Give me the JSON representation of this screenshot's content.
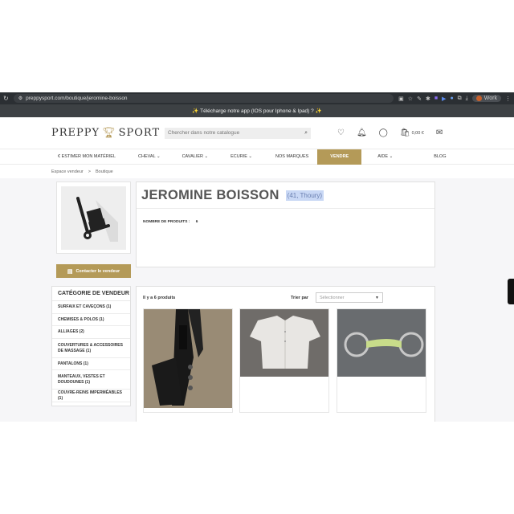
{
  "browser": {
    "url": "preppysport.com/boutique/jeromine-boisson",
    "profile_label": "Work",
    "profile_initial": "M"
  },
  "promo": {
    "text": "✨ Télécharge notre app (IOS pour Iphone & Ipad) ? ✨"
  },
  "header": {
    "logo_left": "PREPPY",
    "logo_right": "SPORT",
    "search_placeholder": "Chercher dans notre catalogue",
    "cart_total": "0,00 €",
    "cart_count": "0"
  },
  "nav": {
    "items": [
      {
        "label": "€ ESTIMER MON MATÉRIEL"
      },
      {
        "label": "CHEVAL ⌄"
      },
      {
        "label": "CAVALIER ⌄"
      },
      {
        "label": "ECURIE ⌄"
      },
      {
        "label": "NOS MARQUES"
      },
      {
        "label": "VENDRE"
      },
      {
        "label": "AIDE ⌄"
      },
      {
        "label": "BLOG"
      }
    ]
  },
  "breadcrumb": {
    "items": [
      "Espace vendeur",
      "Boutique"
    ],
    "separator": ">"
  },
  "vendor": {
    "name": "JEROMINE BOISSON",
    "location": "(41, Thoury)",
    "products_label": "NOMBRE DE PRODUITS :",
    "products_count": "6",
    "contact_label": "Contacter le vendeur"
  },
  "categories": {
    "title": "CATÉGORIE DE VENDEUR",
    "items": [
      {
        "label": "SURFAIX ET CAVEÇONS (1)"
      },
      {
        "label": "CHEMISES & POLOS (1)"
      },
      {
        "label": "ALLIAGES (2)"
      },
      {
        "label": "COUVERTURES & ACCESSOIRES DE MASSAGE (1)"
      },
      {
        "label": "PANTALONS (1)"
      },
      {
        "label": "MANTEAUX, VESTES ET DOUDOUNES (1)"
      },
      {
        "label": "COUVRE-REINS IMPERMÉABLES (1)"
      }
    ]
  },
  "products": {
    "count_text": "Il y a 6 produits",
    "sort_label": "Trier par",
    "sort_value": "Sélectionner"
  },
  "colors": {
    "accent": "#b49a58",
    "banner": "#3d4144",
    "chrome": "#2b2f33"
  }
}
